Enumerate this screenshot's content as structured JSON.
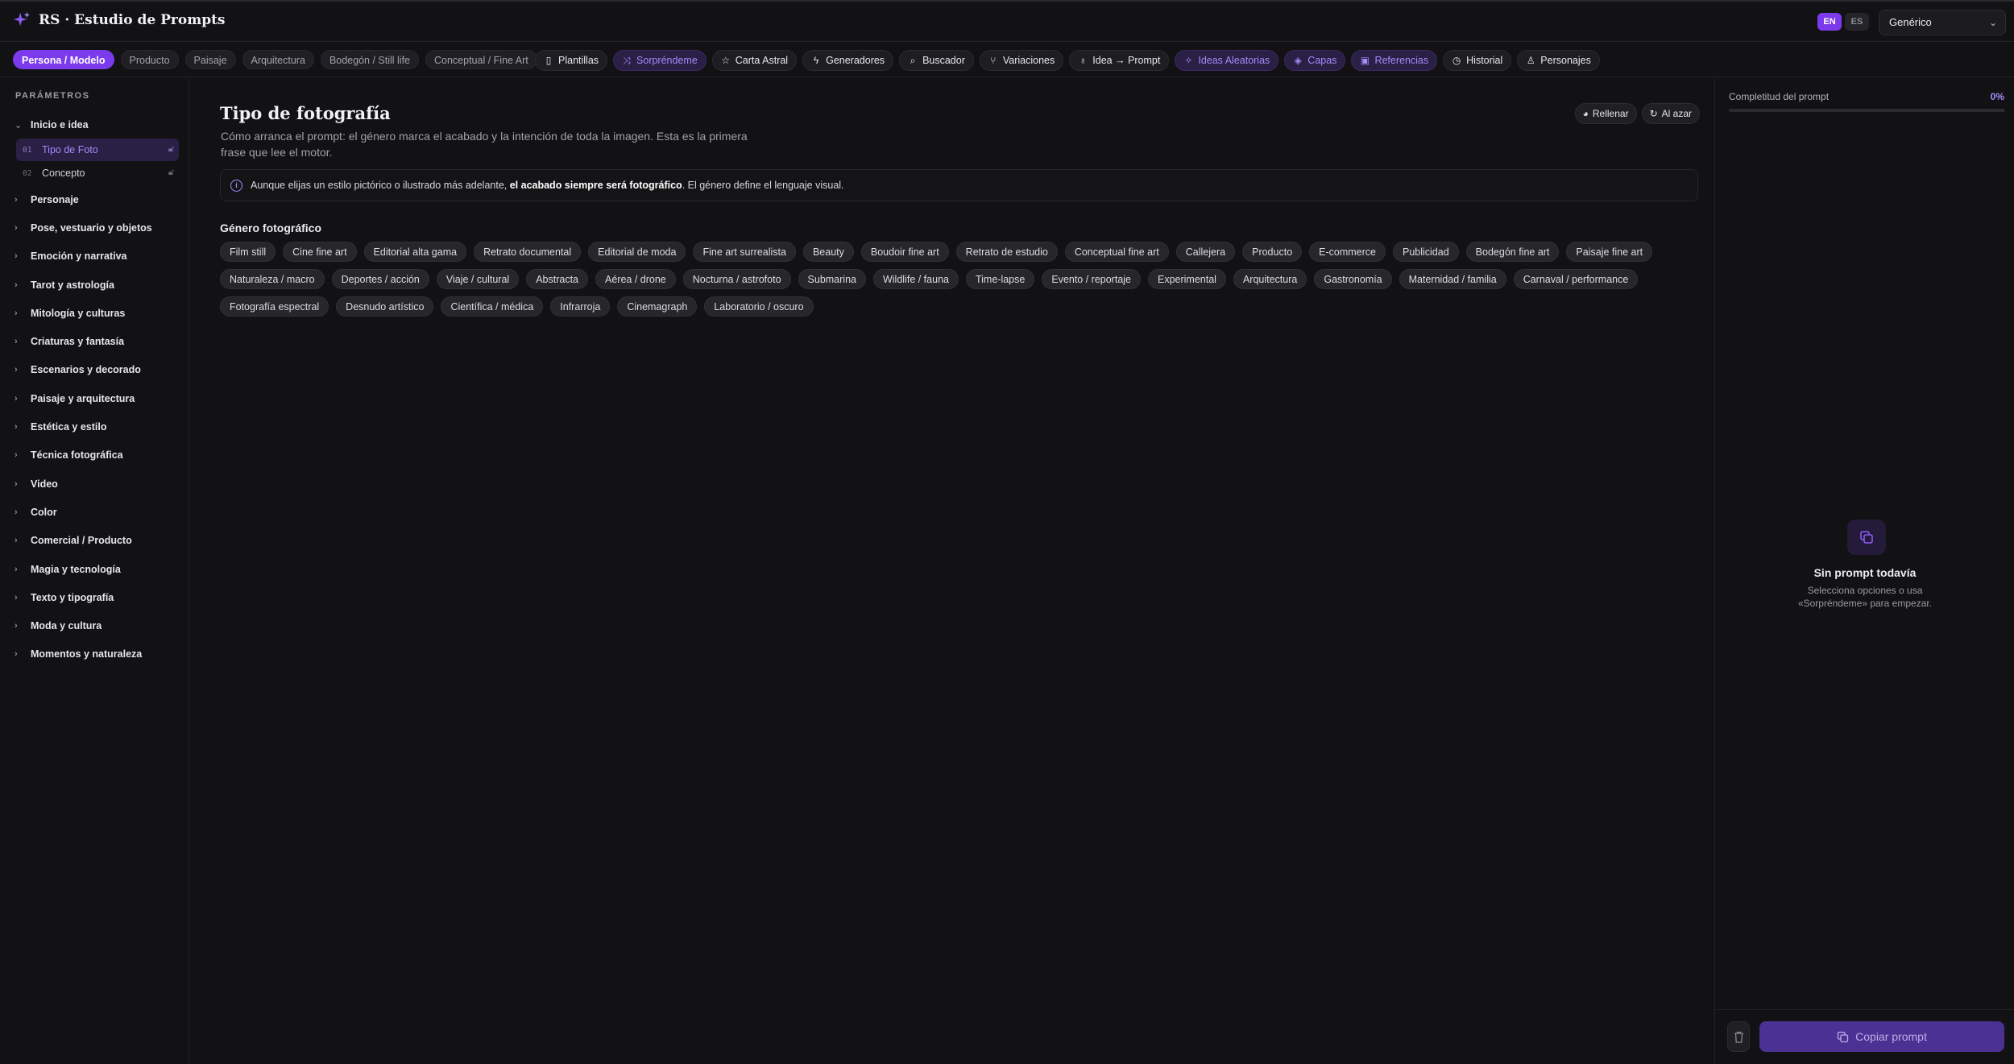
{
  "app": {
    "title": "RS · Estudio de Prompts"
  },
  "languages": {
    "en": "EN",
    "es": "ES"
  },
  "model_select": {
    "value": "Genérico"
  },
  "mode_tabs": [
    {
      "label": "Persona / Modelo"
    },
    {
      "label": "Producto"
    },
    {
      "label": "Paisaje"
    },
    {
      "label": "Arquitectura"
    },
    {
      "label": "Bodegón / Still life"
    },
    {
      "label": "Conceptual / Fine Art"
    }
  ],
  "tools": [
    {
      "label": "Plantillas",
      "icon": "book-icon"
    },
    {
      "label": "Sorpréndeme",
      "icon": "shuffle-icon"
    },
    {
      "label": "Carta Astral",
      "icon": "star-icon"
    },
    {
      "label": "Generadores",
      "icon": "bolt-icon"
    },
    {
      "label": "Buscador",
      "icon": "search-icon"
    },
    {
      "label": "Variaciones",
      "icon": "branch-icon"
    },
    {
      "label": "Idea → Prompt",
      "icon": "bulb-icon"
    },
    {
      "label": "Ideas Aleatorias",
      "icon": "sparkles-icon"
    },
    {
      "label": "Capas",
      "icon": "layers-icon"
    },
    {
      "label": "Referencias",
      "icon": "image-icon"
    },
    {
      "label": "Historial",
      "icon": "clock-icon"
    },
    {
      "label": "Personajes",
      "icon": "user-icon"
    }
  ],
  "sidebar": {
    "title": "PARÁMETROS",
    "first_group": "Inicio e idea",
    "sub_items": [
      {
        "num": "01",
        "label": "Tipo de Foto"
      },
      {
        "num": "02",
        "label": "Concepto"
      }
    ],
    "groups": [
      "Personaje",
      "Pose, vestuario y objetos",
      "Emoción y narrativa",
      "Tarot y astrología",
      "Mitología y culturas",
      "Criaturas y fantasía",
      "Escenarios y decorado",
      "Paisaje y arquitectura",
      "Estética y estilo",
      "Técnica fotográfica",
      "Video",
      "Color",
      "Comercial / Producto",
      "Magia y tecnología",
      "Texto y tipografía",
      "Moda y cultura",
      "Momentos y naturaleza"
    ]
  },
  "main": {
    "title": "Tipo de fotografía",
    "description": "Cómo arranca el prompt: el género marca el acabado y la intención de toda la imagen. Esta es la primera frase que lee el motor.",
    "actions": {
      "fill": "Rellenar",
      "random": "Al azar"
    },
    "notice": {
      "pre": "Aunque elijas un estilo pictórico o ilustrado más adelante, ",
      "bold": "el acabado siempre será fotográfico",
      "post": ". El género define el lenguaje visual."
    },
    "section_title": "Género fotográfico",
    "chips": [
      "Film still",
      "Cine fine art",
      "Editorial alta gama",
      "Retrato documental",
      "Editorial de moda",
      "Fine art surrealista",
      "Beauty",
      "Boudoir fine art",
      "Retrato de estudio",
      "Conceptual fine art",
      "Callejera",
      "Producto",
      "E-commerce",
      "Publicidad",
      "Bodegón fine art",
      "Paisaje fine art",
      "Naturaleza / macro",
      "Deportes / acción",
      "Viaje / cultural",
      "Abstracta",
      "Aérea / drone",
      "Nocturna / astrofoto",
      "Submarina",
      "Wildlife / fauna",
      "Time-lapse",
      "Evento / reportaje",
      "Experimental",
      "Arquitectura",
      "Gastronomía",
      "Maternidad / familia",
      "Carnaval / performance",
      "Fotografía espectral",
      "Desnudo artístico",
      "Científica / médica",
      "Infrarroja",
      "Cinemagraph",
      "Laboratorio / oscuro"
    ]
  },
  "right_panel": {
    "completion_label": "Completitud del prompt",
    "completion_pct": "0%",
    "completion_value": 0,
    "empty_title": "Sin prompt todavía",
    "empty_sub": "Selecciona opciones o usa «Sorpréndeme» para empezar.",
    "copy_label": "Copiar prompt"
  },
  "colors": {
    "accent": "#7c3aed",
    "background": "#121214"
  }
}
